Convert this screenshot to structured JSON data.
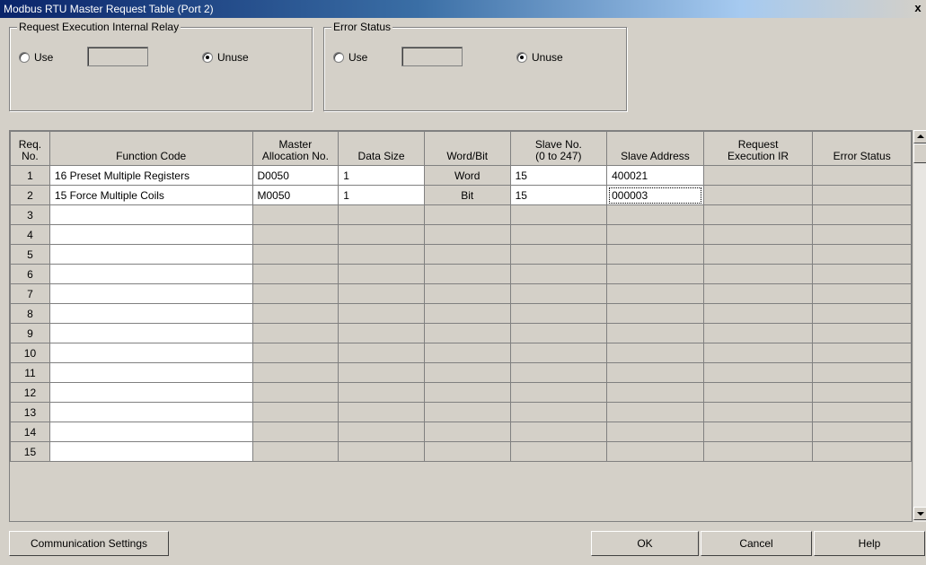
{
  "window": {
    "title": "Modbus RTU Master Request Table (Port 2)",
    "close_label": "x"
  },
  "request_relay": {
    "legend": "Request Execution Internal Relay",
    "use_label": "Use",
    "unuse_label": "Unuse",
    "value": "",
    "selected": "Unuse"
  },
  "error_status": {
    "legend": "Error Status",
    "use_label": "Use",
    "unuse_label": "Unuse",
    "value": "",
    "selected": "Unuse"
  },
  "table": {
    "headers": [
      {
        "line1": "Req.",
        "line2": "No."
      },
      {
        "line1": "",
        "line2": "Function Code"
      },
      {
        "line1": "Master",
        "line2": "Allocation No."
      },
      {
        "line1": "",
        "line2": "Data Size"
      },
      {
        "line1": "",
        "line2": "Word/Bit"
      },
      {
        "line1": "Slave No.",
        "line2": "(0 to 247)"
      },
      {
        "line1": "",
        "line2": "Slave Address"
      },
      {
        "line1": "Request",
        "line2": "Execution IR"
      },
      {
        "line1": "",
        "line2": "Error Status"
      }
    ],
    "rows": [
      [
        "1",
        "16 Preset Multiple Registers",
        "D0050",
        "1",
        "Word",
        "15",
        "400021",
        "",
        ""
      ],
      [
        "2",
        "15 Force Multiple Coils",
        "M0050",
        "1",
        "Bit",
        "15",
        "000003",
        "",
        ""
      ],
      [
        "3",
        "",
        "",
        "",
        "",
        "",
        "",
        "",
        ""
      ],
      [
        "4",
        "",
        "",
        "",
        "",
        "",
        "",
        "",
        ""
      ],
      [
        "5",
        "",
        "",
        "",
        "",
        "",
        "",
        "",
        ""
      ],
      [
        "6",
        "",
        "",
        "",
        "",
        "",
        "",
        "",
        ""
      ],
      [
        "7",
        "",
        "",
        "",
        "",
        "",
        "",
        "",
        ""
      ],
      [
        "8",
        "",
        "",
        "",
        "",
        "",
        "",
        "",
        ""
      ],
      [
        "9",
        "",
        "",
        "",
        "",
        "",
        "",
        "",
        ""
      ],
      [
        "10",
        "",
        "",
        "",
        "",
        "",
        "",
        "",
        ""
      ],
      [
        "11",
        "",
        "",
        "",
        "",
        "",
        "",
        "",
        ""
      ],
      [
        "12",
        "",
        "",
        "",
        "",
        "",
        "",
        "",
        ""
      ],
      [
        "13",
        "",
        "",
        "",
        "",
        "",
        "",
        "",
        ""
      ],
      [
        "14",
        "",
        "",
        "",
        "",
        "",
        "",
        "",
        ""
      ],
      [
        "15",
        "",
        "",
        "",
        "",
        "",
        "",
        "",
        ""
      ]
    ]
  },
  "buttons": {
    "comm_settings": "Communication Settings",
    "ok": "OK",
    "cancel": "Cancel",
    "help": "Help"
  }
}
